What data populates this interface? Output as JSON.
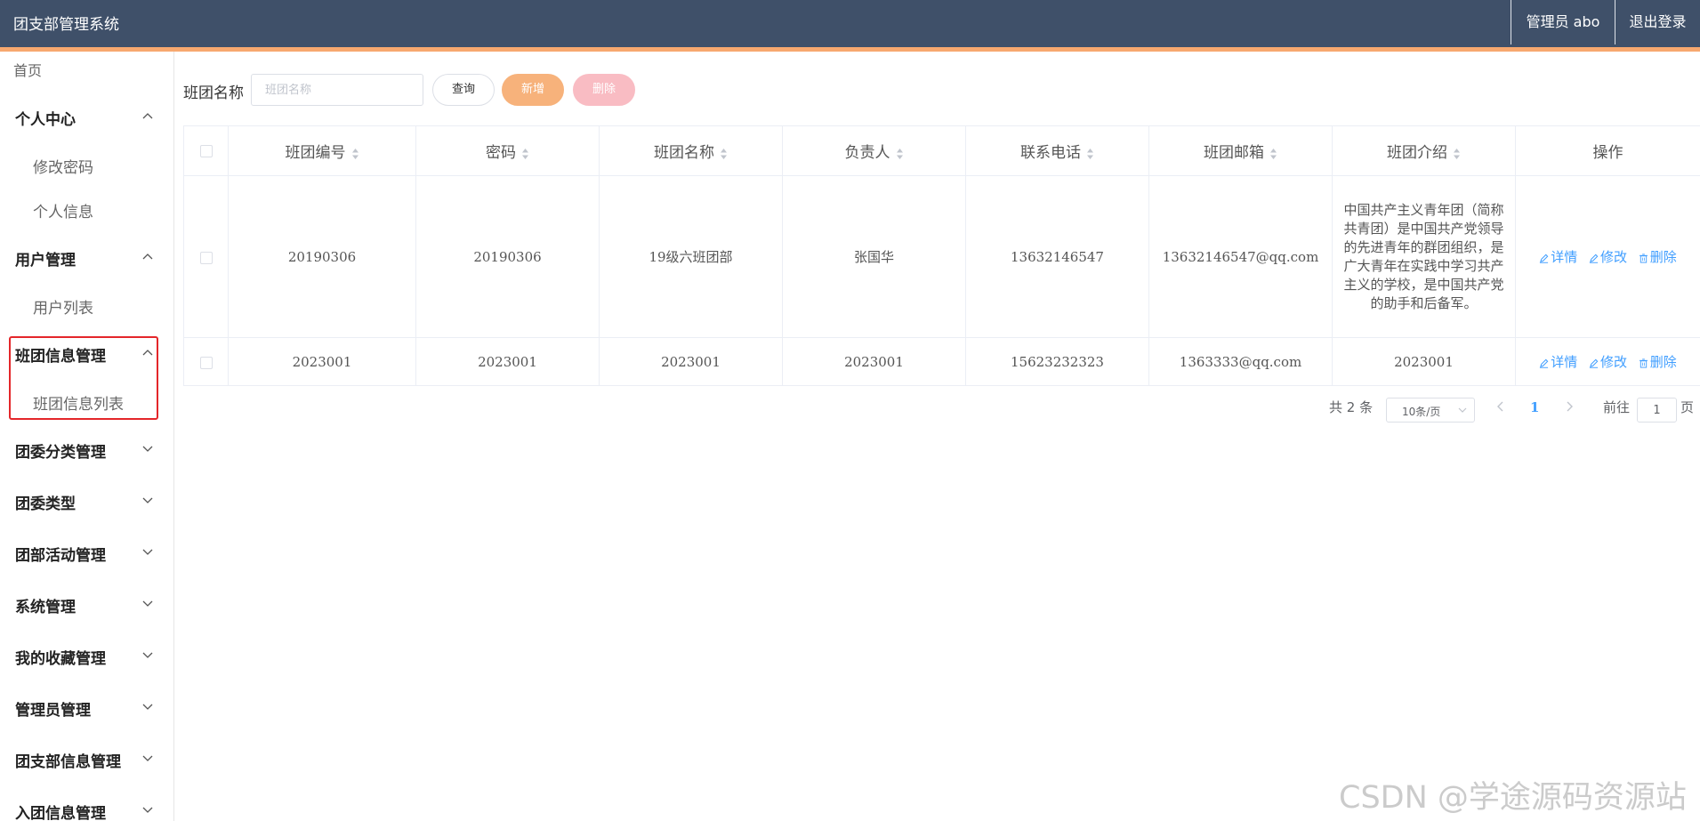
{
  "header": {
    "title": "团支部管理系统",
    "admin_label": "管理员 abo",
    "logout_label": "退出登录"
  },
  "sidebar": {
    "home": "首页",
    "groups": [
      {
        "label": "个人中心",
        "expanded": true,
        "items": [
          "修改密码",
          "个人信息"
        ]
      },
      {
        "label": "用户管理",
        "expanded": true,
        "items": [
          "用户列表"
        ]
      },
      {
        "label": "班团信息管理",
        "expanded": true,
        "items": [
          "班团信息列表"
        ]
      },
      {
        "label": "团委分类管理",
        "expanded": false,
        "items": []
      },
      {
        "label": "团委类型",
        "expanded": false,
        "items": []
      },
      {
        "label": "团部活动管理",
        "expanded": false,
        "items": []
      },
      {
        "label": "系统管理",
        "expanded": false,
        "items": []
      },
      {
        "label": "我的收藏管理",
        "expanded": false,
        "items": []
      },
      {
        "label": "管理员管理",
        "expanded": false,
        "items": []
      },
      {
        "label": "团支部信息管理",
        "expanded": false,
        "items": []
      },
      {
        "label": "入团信息管理",
        "expanded": false,
        "items": []
      }
    ]
  },
  "search": {
    "label": "班团名称",
    "placeholder": "班团名称",
    "query_label": "查询",
    "add_label": "新增",
    "delete_label": "删除"
  },
  "table": {
    "columns": [
      "班团编号",
      "密码",
      "班团名称",
      "负责人",
      "联系电话",
      "班团邮箱",
      "班团介绍",
      "操作"
    ],
    "rows": [
      {
        "id": "20190306",
        "password": "20190306",
        "name": "19级六班团部",
        "leader": "张国华",
        "phone": "13632146547",
        "email": "13632146547@qq.com",
        "intro": "中国共产主义青年团（简称共青团）是中国共产党领导的先进青年的群团组织，是广大青年在实践中学习共产主义的学校，是中国共产党的助手和后备军。"
      },
      {
        "id": "2023001",
        "password": "2023001",
        "name": "2023001",
        "leader": "2023001",
        "phone": "15623232323",
        "email": "1363333@qq.com",
        "intro": "2023001"
      }
    ],
    "actions": {
      "detail": "详情",
      "edit": "修改",
      "delete": "删除"
    }
  },
  "pager": {
    "total": "共 2 条",
    "page_size": "10条/页",
    "current_page": "1",
    "goto_label": "前往",
    "goto_value": "1",
    "unit": "页"
  },
  "watermark": "CSDN @学途源码资源站",
  "colors": {
    "topbar": "#3f5069",
    "accent": "#f7a86f",
    "link": "#409eff",
    "highlight_box": "#e4262a"
  }
}
